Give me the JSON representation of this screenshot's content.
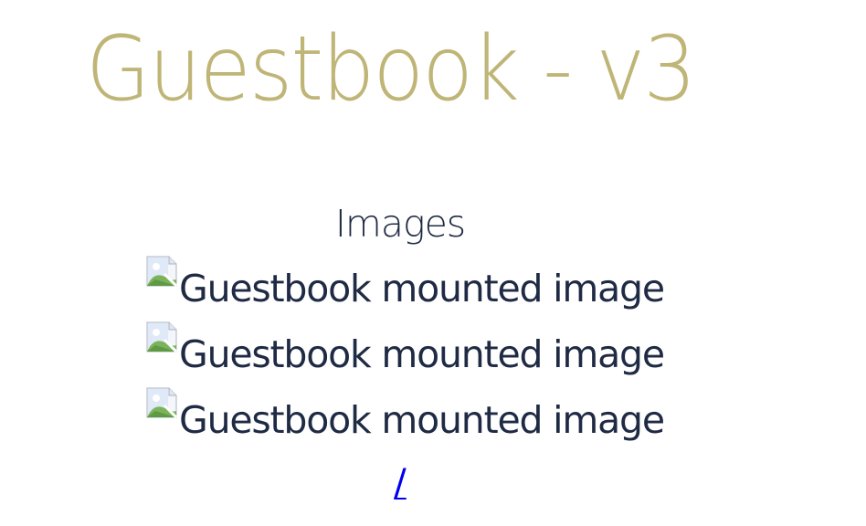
{
  "page": {
    "title": "Guestbook - v3",
    "title_color": "#bfb577"
  },
  "images_section": {
    "heading": "Images",
    "items": [
      {
        "alt": "Guestbook mounted image",
        "icon": "broken-image-icon"
      },
      {
        "alt": "Guestbook mounted image",
        "icon": "broken-image-icon"
      },
      {
        "alt": "Guestbook mounted image",
        "icon": "broken-image-icon"
      }
    ]
  },
  "nav": {
    "root_link": "/",
    "link_color": "#0000ee"
  }
}
